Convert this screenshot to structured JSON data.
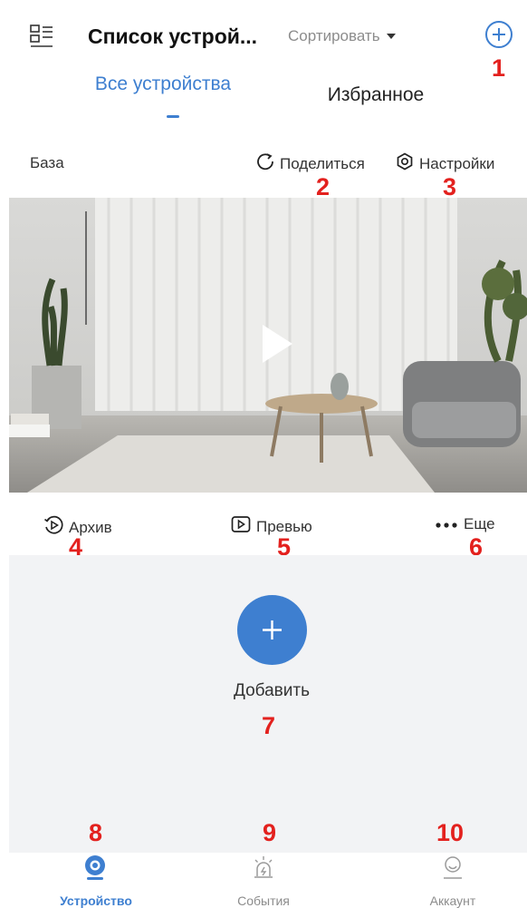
{
  "header": {
    "title": "Список устрой...",
    "sort_label": "Сортировать",
    "add_marker": "1"
  },
  "tabs": [
    {
      "label": "Все устройства",
      "active": true
    },
    {
      "label": "Избранное",
      "active": false
    }
  ],
  "device": {
    "name": "База",
    "share_label": "Поделиться",
    "share_marker": "2",
    "settings_label": "Настройки",
    "settings_marker": "3"
  },
  "device_actions": [
    {
      "label": "Архив",
      "marker": "4"
    },
    {
      "label": "Превью",
      "marker": "5"
    },
    {
      "label": "Еще",
      "marker": "6"
    }
  ],
  "add_block": {
    "label": "Добавить",
    "marker": "7"
  },
  "bottom_nav": [
    {
      "label": "Устройство",
      "marker": "8",
      "active": true
    },
    {
      "label": "События",
      "marker": "9",
      "active": false
    },
    {
      "label": "Аккаунт",
      "marker": "10",
      "active": false
    }
  ],
  "colors": {
    "accent": "#3e7fd0",
    "marker_red": "#e3211e",
    "inactive": "#8c8c8c",
    "background_gray": "#f2f3f5"
  }
}
